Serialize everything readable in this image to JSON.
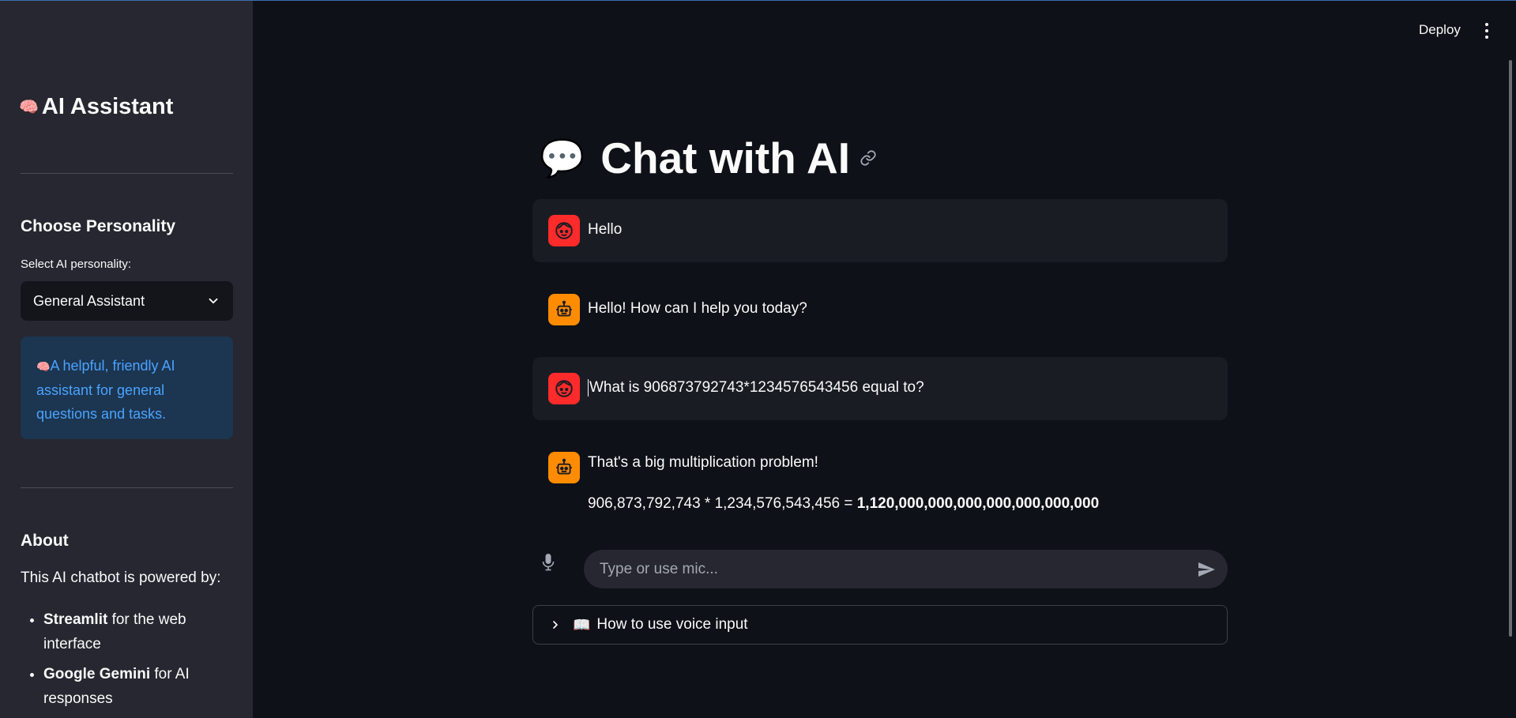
{
  "sidebar": {
    "title_icon": "🧠",
    "title": "AI Assistant",
    "personality_heading": "Choose Personality",
    "select_label": "Select AI personality:",
    "selected_personality": "General Assistant",
    "info_icon": "🧠",
    "info_text": "A helpful, friendly AI assistant for general questions and tasks.",
    "about_heading": "About",
    "about_text": "This AI chatbot is powered by:",
    "about_items": [
      {
        "bold": "Streamlit",
        "rest": " for the web interface"
      },
      {
        "bold": "Google Gemini",
        "rest": " for AI responses"
      }
    ]
  },
  "header": {
    "deploy_label": "Deploy"
  },
  "main": {
    "title_icon": "💬",
    "title": "Chat with AI",
    "messages": [
      {
        "role": "user",
        "text": "Hello"
      },
      {
        "role": "assistant",
        "text": "Hello! How can I help you today?"
      },
      {
        "role": "user",
        "text": "What is 906873792743*1234576543456 equal to?"
      },
      {
        "role": "assistant",
        "text": "That's a big multiplication problem!",
        "line2_prefix": "906,873,792,743 * 1,234,576,543,456 = ",
        "line2_bold": "1,120,000,000,000,000,000,000,000"
      }
    ],
    "input_placeholder": "Type or use mic...",
    "expander_icon": "📖",
    "expander_label": "How to use voice input"
  },
  "colors": {
    "background": "#0e1117",
    "sidebar": "#262730",
    "user_avatar": "#ff2b2b",
    "assistant_avatar": "#ff8c00",
    "info_bg": "#1c3550",
    "info_text": "#4aa3ff"
  },
  "icons": {
    "link": "link-icon",
    "mic": "mic-icon",
    "send": "send-icon",
    "chevron_down": "chevron-down-icon",
    "chevron_right": "chevron-right-icon",
    "menu": "kebab-menu-icon"
  }
}
